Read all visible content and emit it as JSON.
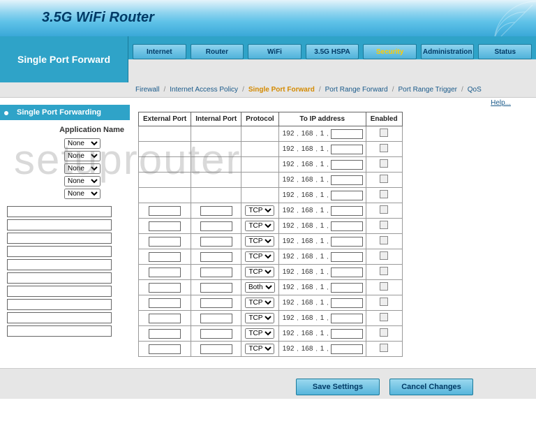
{
  "banner": {
    "title": "3.5G WiFi Router"
  },
  "page_title": "Single Port Forward",
  "tabs": [
    "Internet",
    "Router",
    "WiFi",
    "3.5G HSPA",
    "Security",
    "Administration",
    "Status"
  ],
  "tab_active_index": 4,
  "subnav": {
    "items": [
      "Firewall",
      "Internet Access Policy",
      "Single Port Forward",
      "Port Range Forward",
      "Port Range Trigger",
      "QoS"
    ],
    "active_index": 2
  },
  "sidebar": {
    "header": "Single Port Forwarding",
    "label": "Application Name",
    "app_selects": [
      "None",
      "None",
      "None",
      "None",
      "None"
    ],
    "text_inputs": [
      "",
      "",
      "",
      "",
      "",
      "",
      "",
      "",
      "",
      ""
    ]
  },
  "help_label": "Help...",
  "table": {
    "headers": [
      "External Port",
      "Internal Port",
      "Protocol",
      "To IP address",
      "Enabled"
    ],
    "ip_prefix": [
      "192",
      "168",
      "1"
    ],
    "top_rows": 5,
    "bottom_rows_protocols": [
      "TCP",
      "TCP",
      "TCP",
      "TCP",
      "TCP",
      "Both",
      "TCP",
      "TCP",
      "TCP",
      "TCP"
    ]
  },
  "buttons": {
    "save": "Save Settings",
    "cancel": "Cancel Changes"
  },
  "watermark": "setuprouter"
}
